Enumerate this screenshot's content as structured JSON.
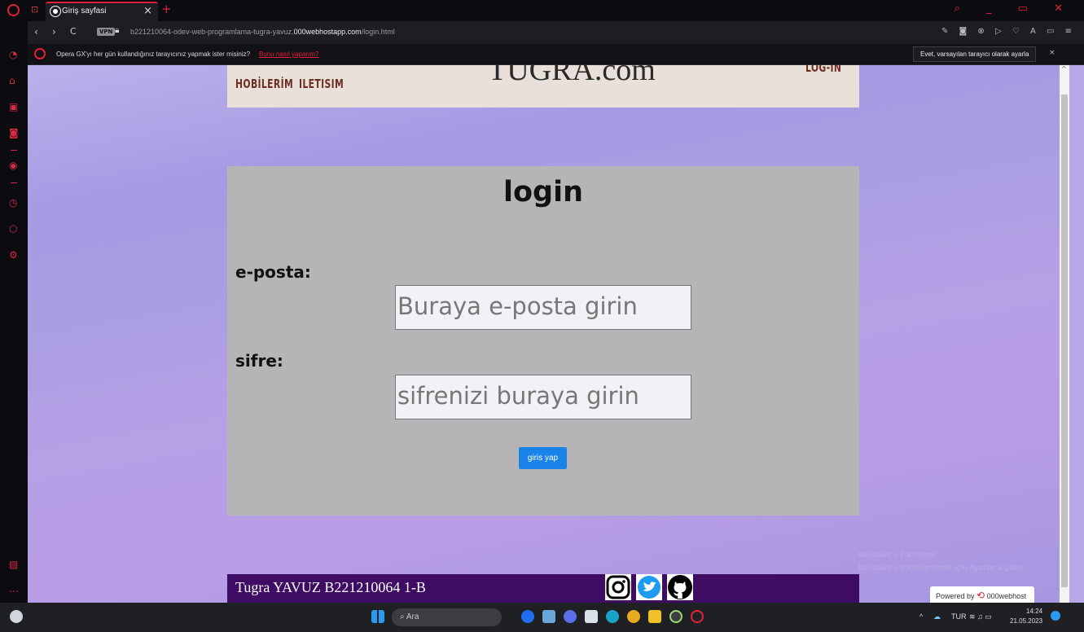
{
  "browser": {
    "tab_title": "Giriş sayfasi",
    "tab_close": "×",
    "new_tab": "+",
    "vpn_badge": "VPN",
    "url_prefix": "b221210064-odev-web-programlama-tugra-yavuz.",
    "url_domain": "000webhostapp.com",
    "url_suffix": "/login.html",
    "back": "‹",
    "forward": "›",
    "reload": "C"
  },
  "infobar": {
    "message": "Opera GX'yı her gün kullandığınız tarayıcınız yapmak ister misiniz?",
    "link": "Bunu nasıl yaparım?",
    "button": "Evet, varsayılan tarayıcı olarak ayarla",
    "close": "×"
  },
  "header": {
    "nav_hobbies": "HOBİLERİM",
    "nav_contact": "ILETISIM",
    "brand": "TUGRA.com",
    "nav_login": "LOG-IN"
  },
  "login": {
    "title": "login",
    "email_label": "e-posta:",
    "email_placeholder": "Buraya e-posta girin",
    "password_label": "sifre:",
    "password_placeholder": "sifrenizi buraya girin",
    "submit": "giris yap"
  },
  "footer": {
    "text": "Tugra YAVUZ B221210064 1-B",
    "social": [
      "instagram-icon",
      "twitter-icon",
      "github-icon"
    ]
  },
  "powered": {
    "prefix": "Powered by",
    "brand": "000webhost"
  },
  "taskbar": {
    "search": "Ara",
    "language": "TUR",
    "time": "14:24",
    "date": "21.05.2023"
  },
  "colors": {
    "accent": "#e0213a",
    "header_bg": "#e9e0d9",
    "card_bg": "#b5b4b7",
    "footer_bg": "#3e0c62",
    "button": "#1a83ea"
  }
}
